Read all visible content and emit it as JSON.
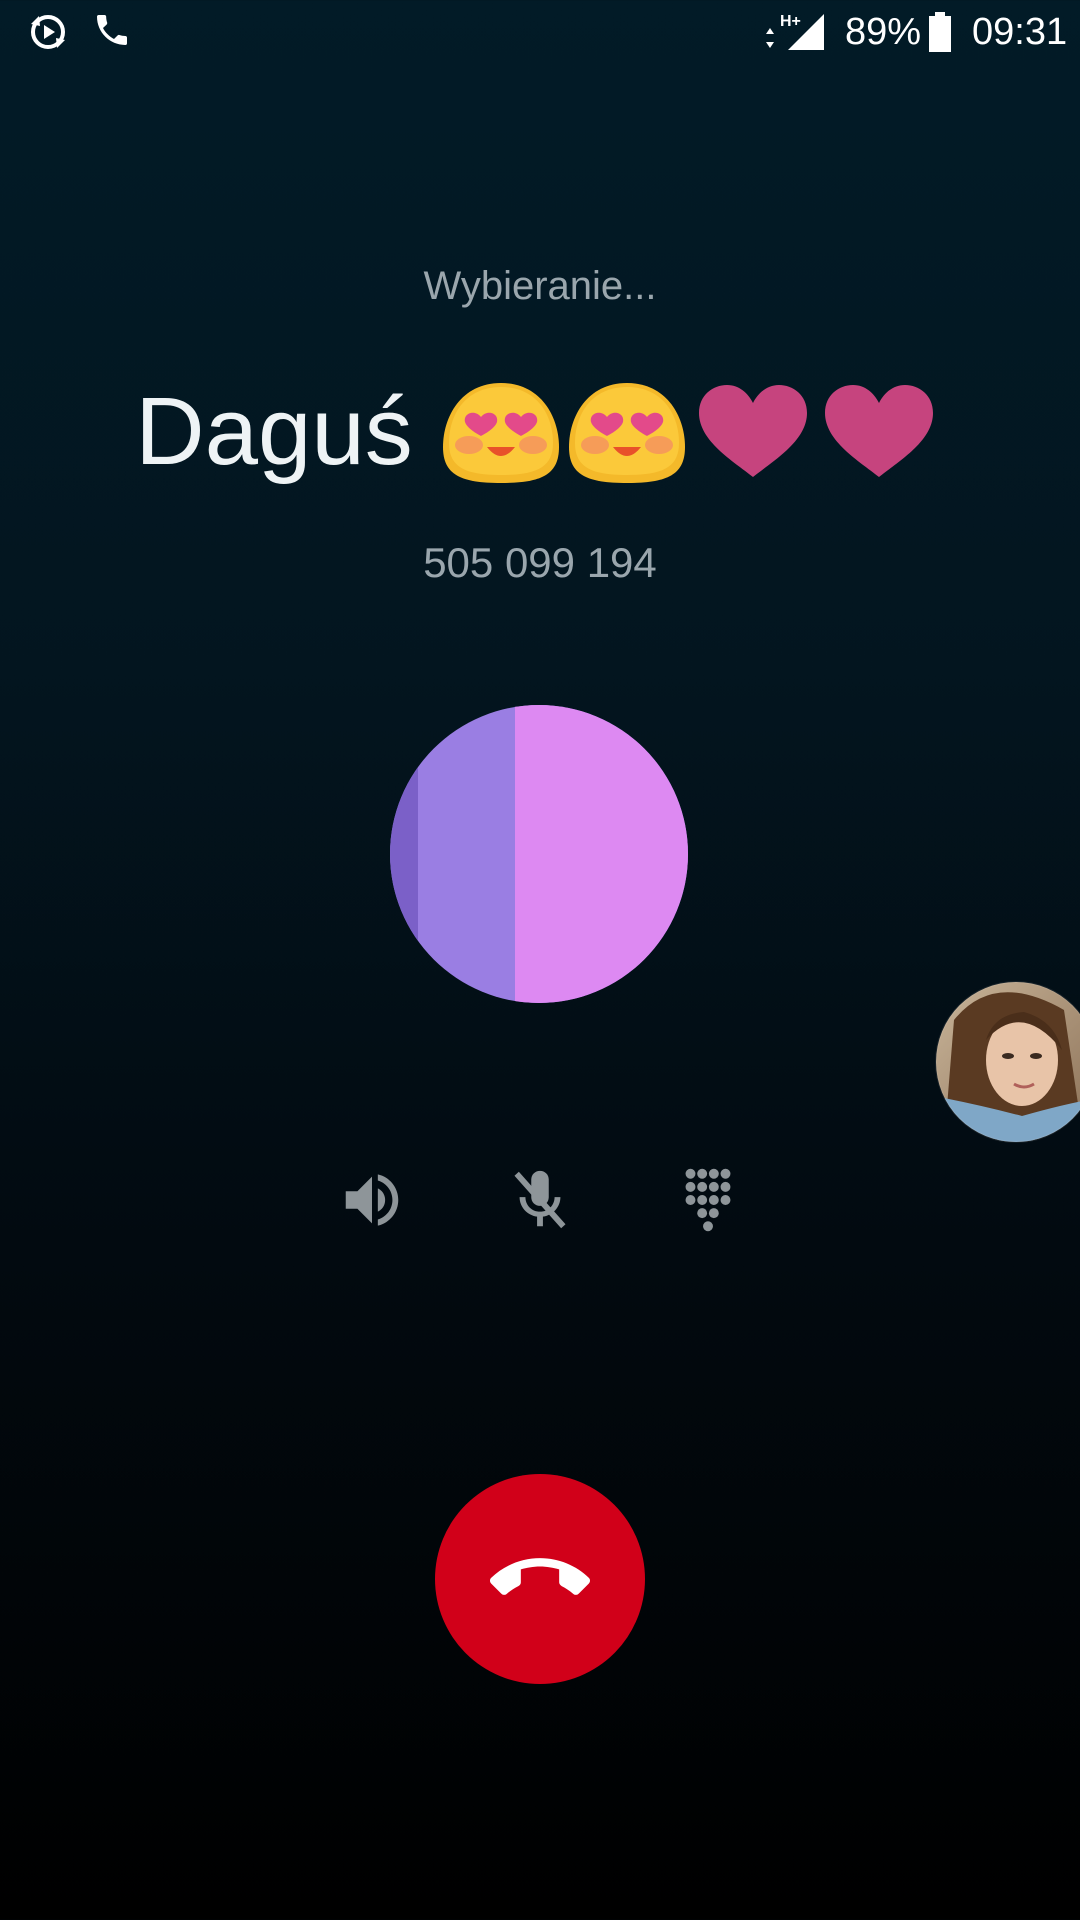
{
  "status_bar": {
    "left_icons": [
      "sync-play-icon",
      "phone-icon"
    ],
    "network": "H+",
    "battery_percent": "89%",
    "time": "09:31"
  },
  "call": {
    "status": "Wybieranie...",
    "contact_name": "Daguś",
    "name_emojis": [
      "heart-eyes-emoji",
      "heart-eyes-emoji",
      "pink-heart-emoji",
      "pink-heart-emoji"
    ],
    "phone_number": "505 099 194"
  },
  "colors": {
    "end_call": "#d10019",
    "avatar_left": "#9a7ee3",
    "avatar_right": "#dd89f2",
    "avatar_edge": "#7b60c8",
    "secondary_text": "#9aa6ad"
  },
  "controls": [
    {
      "name": "speaker-icon"
    },
    {
      "name": "mute-icon"
    },
    {
      "name": "dialpad-icon"
    }
  ],
  "end_call": {
    "icon": "end-call-icon"
  }
}
